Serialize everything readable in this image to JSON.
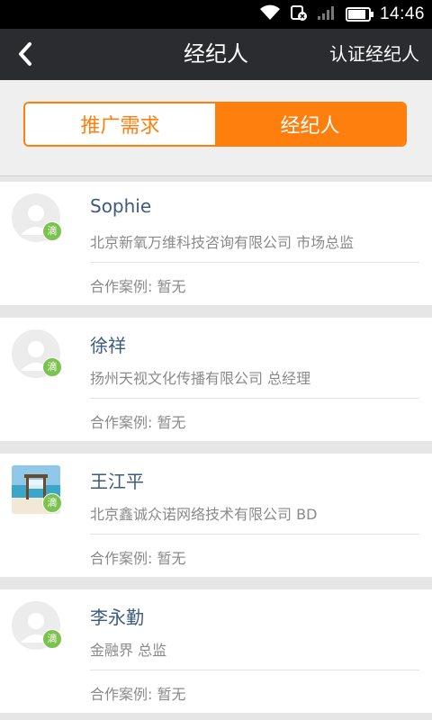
{
  "status": {
    "time": "14:46"
  },
  "nav": {
    "title": "经纪人",
    "action": "认证经纪人"
  },
  "tabs": [
    {
      "label": "推广需求",
      "active": false
    },
    {
      "label": "经纪人",
      "active": true
    }
  ],
  "agents": [
    {
      "name": "Sophie",
      "company": "北京新氧万维科技咨询有限公司 市场总监",
      "cases": "合作案例: 暂无",
      "badge": "滴",
      "avatar": "default"
    },
    {
      "name": "徐祥",
      "company": "扬州天视文化传播有限公司 总经理",
      "cases": "合作案例: 暂无",
      "badge": "滴",
      "avatar": "default"
    },
    {
      "name": "王江平",
      "company": "北京鑫诚众诺网络技术有限公司 BD",
      "cases": "合作案例: 暂无",
      "badge": "滴",
      "avatar": "beach-photo"
    },
    {
      "name": "李永勤",
      "company": "金融界 总监",
      "cases": "合作案例: 暂无",
      "badge": "滴",
      "avatar": "default"
    }
  ],
  "colors": {
    "accent": "#ff7f0e",
    "navbar": "#2b2c30",
    "name": "#3d5a80",
    "badge": "#7cc24f"
  }
}
